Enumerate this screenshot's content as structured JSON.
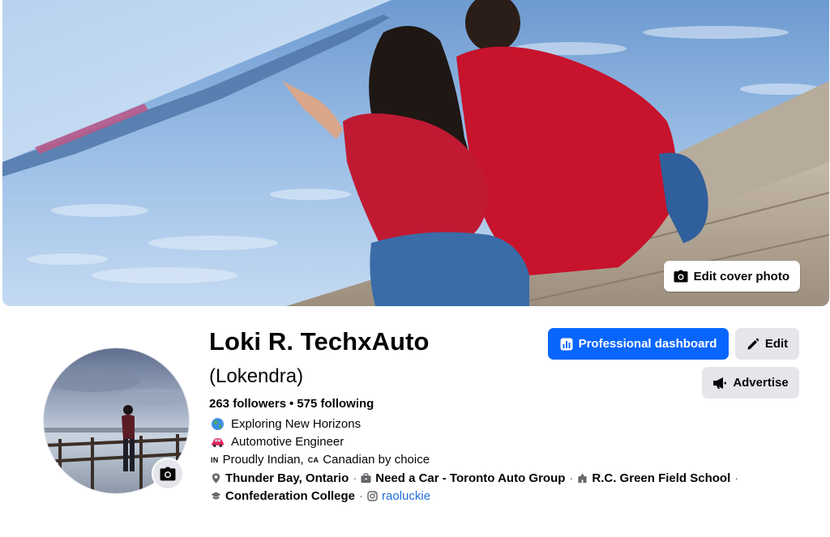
{
  "cover": {
    "edit_label": "Edit cover photo",
    "icon": "camera-icon"
  },
  "profile": {
    "name": "Loki R. TechxAuto",
    "alternate_name": "(Lokendra)",
    "followers": "263 followers",
    "separator": "•",
    "following": "575 following"
  },
  "bio": [
    {
      "icon": "globe-emoji",
      "text": "Exploring New Horizons"
    },
    {
      "icon": "car-emoji",
      "text": "Automotive Engineer"
    },
    {
      "flag_in": "IN",
      "text_a": "Proudly Indian,",
      "flag_ca": "CA",
      "text_b": "Canadian by choice"
    }
  ],
  "details": {
    "location": "Thunder Bay, Ontario",
    "work": "Need a Car - Toronto Auto Group",
    "school": "R.C. Green Field School",
    "college": "Confederation College",
    "instagram": "raoluckie",
    "dot": "·"
  },
  "actions": {
    "professional_dashboard": "Professional dashboard",
    "edit": "Edit",
    "advertise": "Advertise"
  },
  "colors": {
    "primary": "#0866ff",
    "secondary_button": "#e4e6eb",
    "link": "#216fdb",
    "text": "#050505"
  }
}
